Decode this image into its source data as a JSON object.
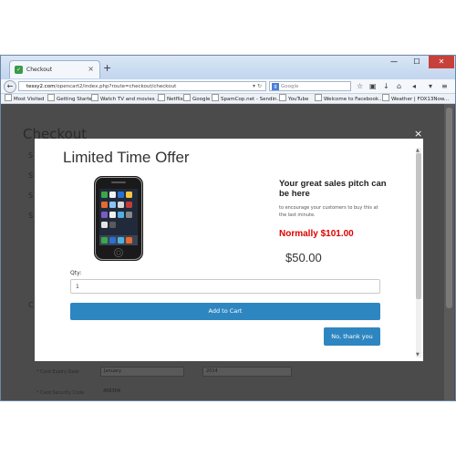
{
  "browser": {
    "tab_title": "Checkout",
    "tab_favicon": "opencart-icon",
    "new_tab": "+",
    "url_host": "tessy2.com",
    "url_path": "/opencart2/index.php?route=checkout/checkout",
    "search_engine": "Google",
    "search_placeholder": "Google"
  },
  "bookmarks": [
    "Most Visited",
    "Getting Started",
    "Watch TV and movies ...",
    "Netflix",
    "Google",
    "SpamCop.net - Sendin...",
    "YouTube",
    "Welcome to Facebook...",
    "Weather | FOX13Now..."
  ],
  "page": {
    "title": "Checkout",
    "expiry_month": "January",
    "expiry_year": "2014",
    "expiry_label": "* Card Expiry Date",
    "cvv_label": "* Card Security Code",
    "cvv_value": "456304"
  },
  "modal": {
    "title": "Limited Time Offer",
    "pitch": "Your great sales pitch can be here",
    "subtext": "to encourage your customers to buy this at the last minute.",
    "normally": "Normally $101.00",
    "price": "$50.00",
    "qty_label": "Qty:",
    "qty_value": "1",
    "add_to_cart": "Add to Cart",
    "no_thanks": "No, thank you",
    "close": "×"
  },
  "colors": {
    "button_blue": "#2e86c1",
    "normal_price_red": "#e00000",
    "overlay": "#4b4b4b"
  }
}
